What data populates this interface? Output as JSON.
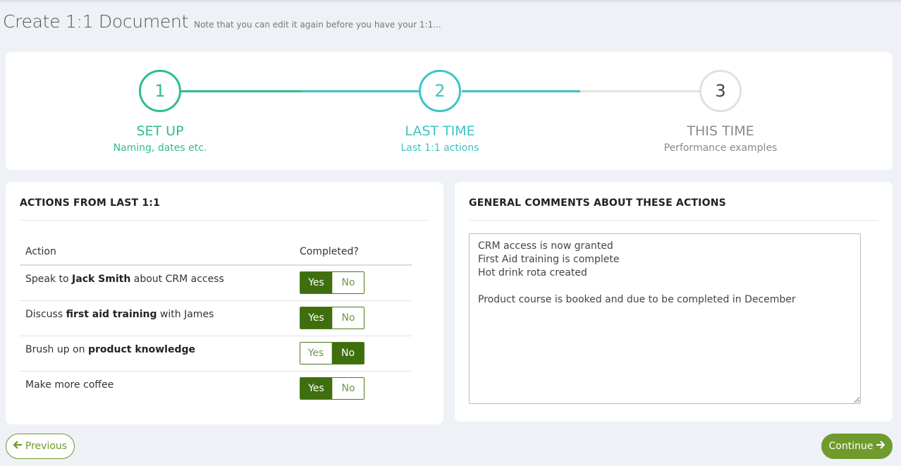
{
  "header": {
    "title": "Create 1:1 Document",
    "subtitle": "Note that you can edit it again before you have your 1:1..."
  },
  "steps": [
    {
      "number": "1",
      "title": "SET UP",
      "subtitle": "Naming, dates etc."
    },
    {
      "number": "2",
      "title": "LAST TIME",
      "subtitle": "Last 1:1 actions"
    },
    {
      "number": "3",
      "title": "THIS TIME",
      "subtitle": "Performance examples"
    }
  ],
  "actions_card": {
    "heading": "ACTIONS FROM LAST 1:1",
    "columns": {
      "action": "Action",
      "completed": "Completed?"
    },
    "toggle_labels": {
      "yes": "Yes",
      "no": "No"
    },
    "rows": [
      {
        "pre": "Speak to ",
        "bold": "Jack Smith",
        "post": " about CRM access",
        "completed": "Yes"
      },
      {
        "pre": "Discuss ",
        "bold": "first aid training",
        "post": " with James",
        "completed": "Yes"
      },
      {
        "pre": "Brush up on ",
        "bold": "product knowledge",
        "post": "",
        "completed": "No"
      },
      {
        "pre": "Make more coffee",
        "bold": "",
        "post": "",
        "completed": "Yes"
      }
    ]
  },
  "comments_card": {
    "heading": "GENERAL COMMENTS ABOUT THESE ACTIONS",
    "value": "CRM access is now granted\nFirst Aid training is complete\nHot drink rota created\n\nProduct course is booked and due to be completed in December"
  },
  "buttons": {
    "previous": "Previous",
    "continue": "Continue"
  },
  "colors": {
    "step1": "#2dbd8e",
    "step2": "#3cc4c4",
    "toggle_active": "#3f6e0e",
    "button": "#6f9a2c"
  }
}
